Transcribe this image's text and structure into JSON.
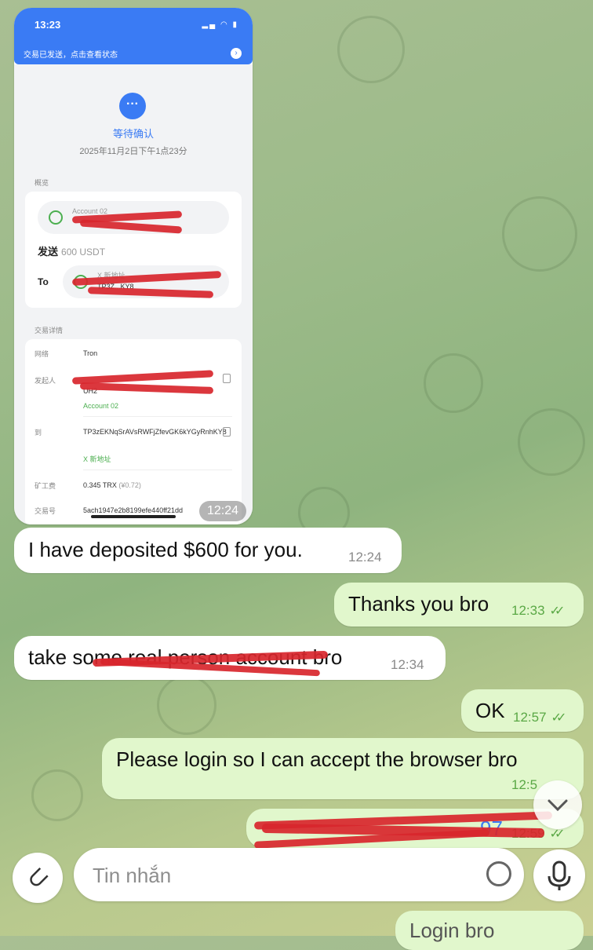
{
  "screenshot": {
    "phone_time": "13:23",
    "banner_text": "交易已发送，点击查看状态",
    "status_title": "等待确认",
    "status_date": "2025年11月2日下午1点23分",
    "overview_label": "概览",
    "from_account_label": "Account 02",
    "send_label": "发送",
    "send_amount": "600 USDT",
    "to_label": "To",
    "to_account_label": "X 新地址",
    "to_address_partial": "TP3Z...KY8",
    "details_label": "交易详情",
    "network_label": "网络",
    "network_value": "Tron",
    "initiator_label": "发起人",
    "initiator_value_partial": "UH2",
    "initiator_account": "Account 02",
    "to_row_label": "到",
    "to_row_address": "TP3zEKNqSrAVsRWFjZfevGK6kYGyRnhKY8",
    "to_row_account": "X 新地址",
    "fee_label": "矿工费",
    "fee_value": "0.345 TRX",
    "fee_fiat": "(¥0.72)",
    "hash_label": "交易号",
    "hash_value_partial": "5ach1947e2b8199efe440ff21dd",
    "time": "12:24"
  },
  "messages": [
    {
      "dir": "in",
      "text": "I have deposited $600 for you.",
      "time": "12:24"
    },
    {
      "dir": "out",
      "text": "Thanks you bro",
      "time": "12:33"
    },
    {
      "dir": "in",
      "text": "take some real person account bro",
      "time": "12:34"
    },
    {
      "dir": "out",
      "text": "OK",
      "time": "12:57"
    },
    {
      "dir": "out",
      "text": "Please login so I can accept the browser bro",
      "time": "12:5"
    },
    {
      "dir": "out",
      "text": "97",
      "time": "12:59"
    },
    {
      "dir": "out",
      "text": "Login bro",
      "time": ""
    }
  ],
  "input": {
    "placeholder": "Tin nhắn"
  },
  "icons": {
    "attach": "paperclip-icon",
    "sticker": "sticker-icon",
    "mic": "microphone-icon",
    "scroll": "chevron-down-icon"
  },
  "colors": {
    "accent_blue": "#3a7bf4",
    "out_bubble": "#e1f7cc",
    "scribble_red": "#d8262c"
  }
}
